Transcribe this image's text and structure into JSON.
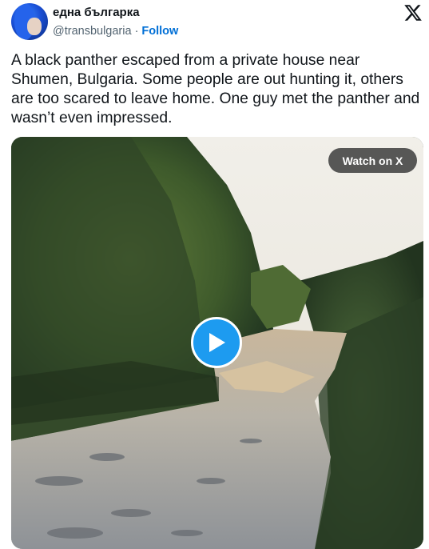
{
  "author": {
    "display_name": "една българка",
    "handle": "@transbulgaria",
    "separator": "·",
    "follow_label": "Follow",
    "avatar": "avatar-blue-hair"
  },
  "platform_logo": "x-logo",
  "tweet": {
    "text": "A black panther escaped from a private house near Shumen, Bulgaria. Some people are out hunting it, others are too scared to leave home. One guy met the panther and wasn’t even impressed."
  },
  "media": {
    "watch_label": "Watch on X",
    "play_icon": "play-icon",
    "accent_color": "#1d9bf0"
  },
  "colors": {
    "follow": "#006fd6",
    "text": "#0f1419",
    "secondary": "#536471"
  }
}
